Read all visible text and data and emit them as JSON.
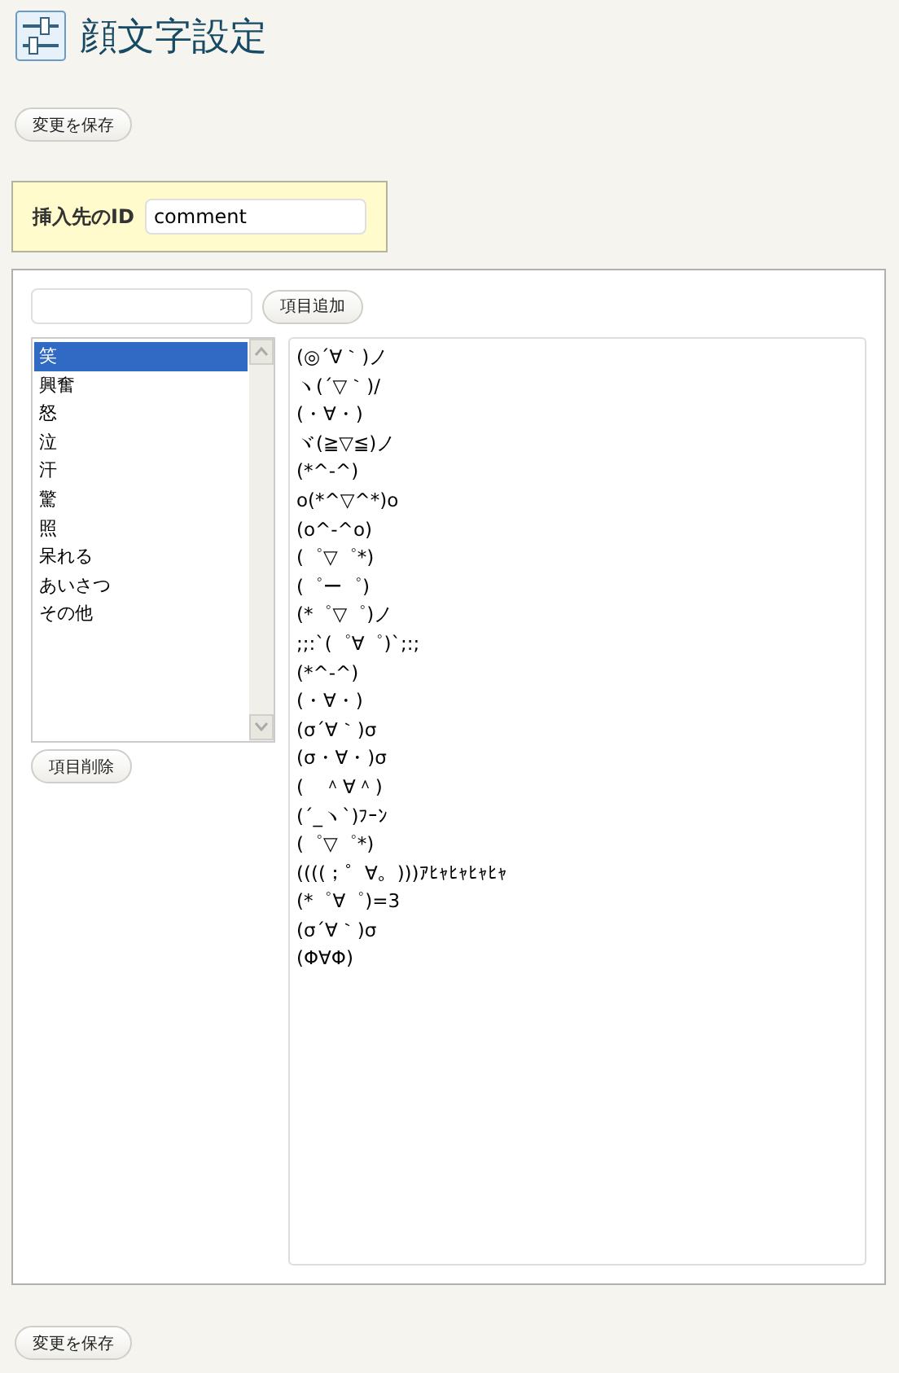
{
  "page": {
    "title": "顔文字設定"
  },
  "save_button_top": "変更を保存",
  "insert_target": {
    "label": "挿入先のID",
    "value": "comment"
  },
  "new_item": {
    "button": "項目追加"
  },
  "categories": [
    {
      "label": "笑",
      "selected": true
    },
    {
      "label": "興奮",
      "selected": false
    },
    {
      "label": "怒",
      "selected": false
    },
    {
      "label": "泣",
      "selected": false
    },
    {
      "label": "汗",
      "selected": false
    },
    {
      "label": "驚",
      "selected": false
    },
    {
      "label": "照",
      "selected": false
    },
    {
      "label": "呆れる",
      "selected": false
    },
    {
      "label": "あいさつ",
      "selected": false
    },
    {
      "label": "その他",
      "selected": false
    }
  ],
  "delete_button": "項目削除",
  "emoticons": [
    "(◎´∀｀)ノ",
    "ヽ(´▽｀)/",
    "(・∀・)",
    "ヾ(≧▽≦)ノ",
    "(*^-^)",
    "o(*^▽^*)o",
    "(o^-^o)",
    "(゜▽゜*)",
    "(゜ー゜)",
    "(*゜▽゜)ノ",
    ";;:`(゜∀゜)`;:;",
    "(*^-^)",
    "(・∀・)",
    "(σ´∀｀)σ",
    "(σ・∀・)σ",
    "(　＾∀＾)",
    "(´_ヽ`)ﾌｰﾝ",
    "(゜▽゜*)",
    "((((；゜∀。)))ｱﾋｬﾋｬﾋｬﾋｬ",
    "(*゜∀゜)=3",
    "(σ´∀｀)σ",
    "(Φ∀Φ)"
  ],
  "save_button_bottom": "変更を保存"
}
